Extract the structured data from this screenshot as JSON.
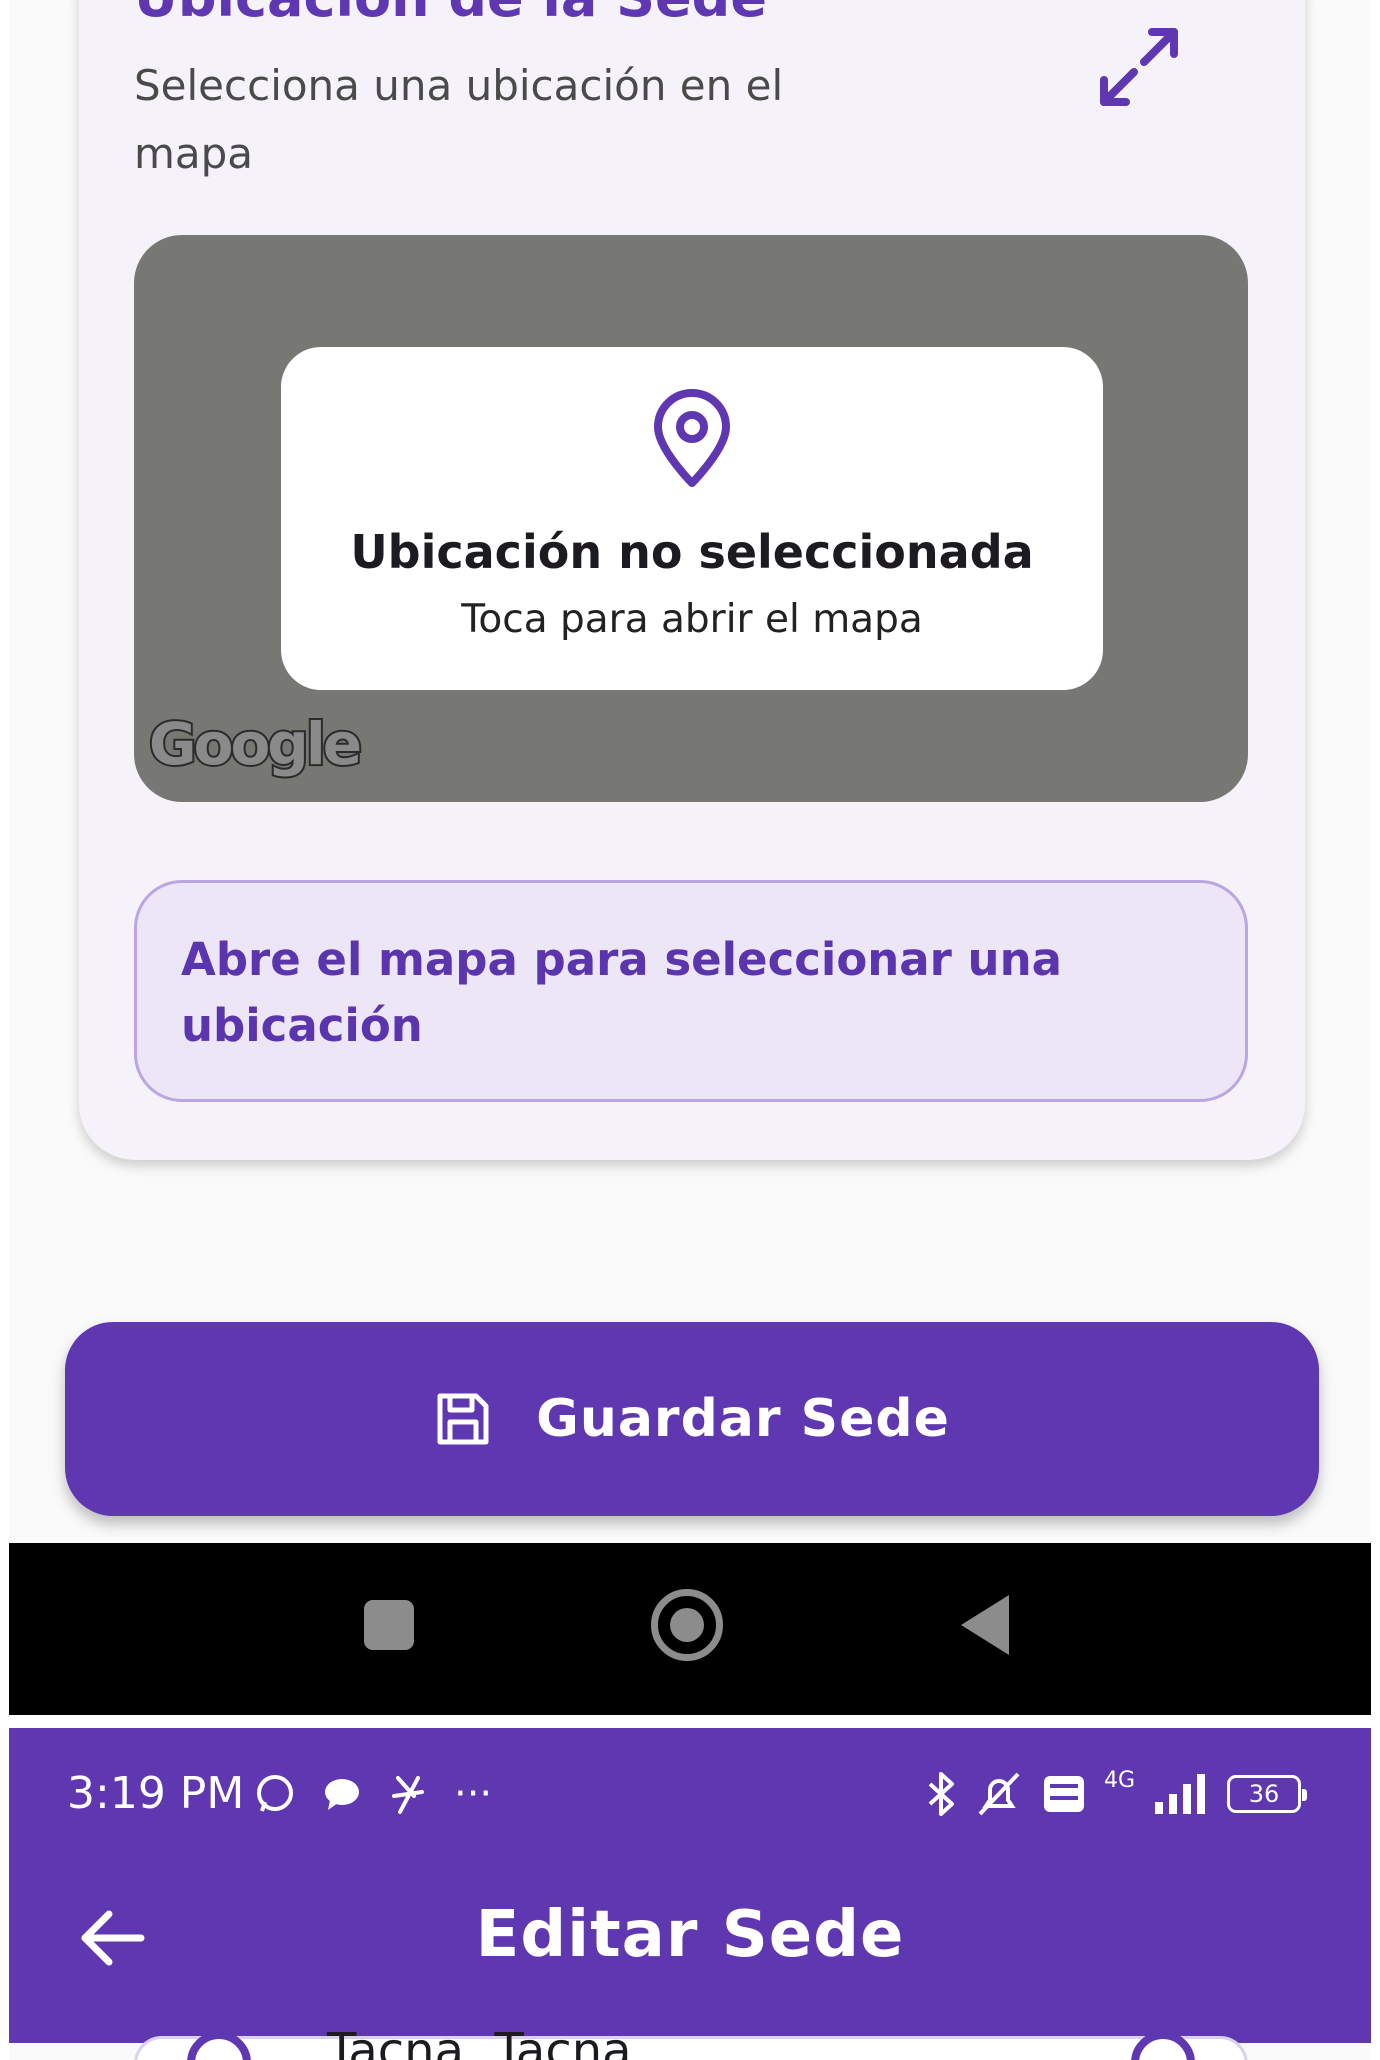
{
  "location_section": {
    "title": "Ubicación de la Sede",
    "subtitle": "Selecciona una ubicación en el mapa",
    "expand_icon": "expand-arrows-icon"
  },
  "map": {
    "pin_icon": "location-pin-icon",
    "status_title": "Ubicación no seleccionada",
    "status_subtitle": "Toca para abrir el mapa",
    "attribution": "Google"
  },
  "hint": {
    "text": "Abre el mapa para seleccionar una ubicación"
  },
  "save_button": {
    "label": "Guardar Sede",
    "icon": "floppy-disk-icon"
  },
  "status_bar": {
    "time": "3:19 PM",
    "more": "···",
    "network": "4G",
    "battery": "36"
  },
  "app_bar": {
    "title": "Editar Sede",
    "back_icon": "back-arrow-icon"
  },
  "peek_row": {
    "text": "Tacna, Tacna"
  },
  "colors": {
    "primary": "#5e37b1",
    "card_bg": "#f5f2fa",
    "map_bg": "#777774",
    "hint_bg": "#ece6f6"
  }
}
